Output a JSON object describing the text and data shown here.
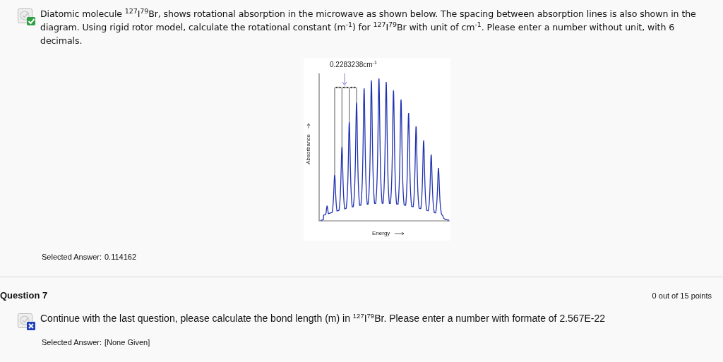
{
  "questions": [
    {
      "correct": true,
      "text": "Diatomic molecule $^{127}$I$^{79}$Br, shows rotational absorption in the microwave as shown below. The spacing between absorption lines is also shown in the diagram.  Using rigid rotor model, calculate the rotational constant (m$^{-1}$) for $^{127}$I$^{79}$Br with unit of cm$^{-1}$.  Please enter a number without unit, with 6 decimals.",
      "figure": {
        "spacing_label": "0.2283238cm$^{-1}$",
        "ylabel": "Absorbance",
        "xlabel": "Energy"
      },
      "answer_label": "Selected Answer:",
      "answer": "0.114162"
    },
    {
      "title": "Question 7",
      "points": "0 out of 15 points",
      "correct": false,
      "text": "Continue with the last question, please calculate the bond length (m) in $^{127}$I$^{79}$Br.  Please enter a number with formate of 2.567E-22",
      "answer_label": "Selected Answer:",
      "answer": "[None Given]"
    }
  ]
}
